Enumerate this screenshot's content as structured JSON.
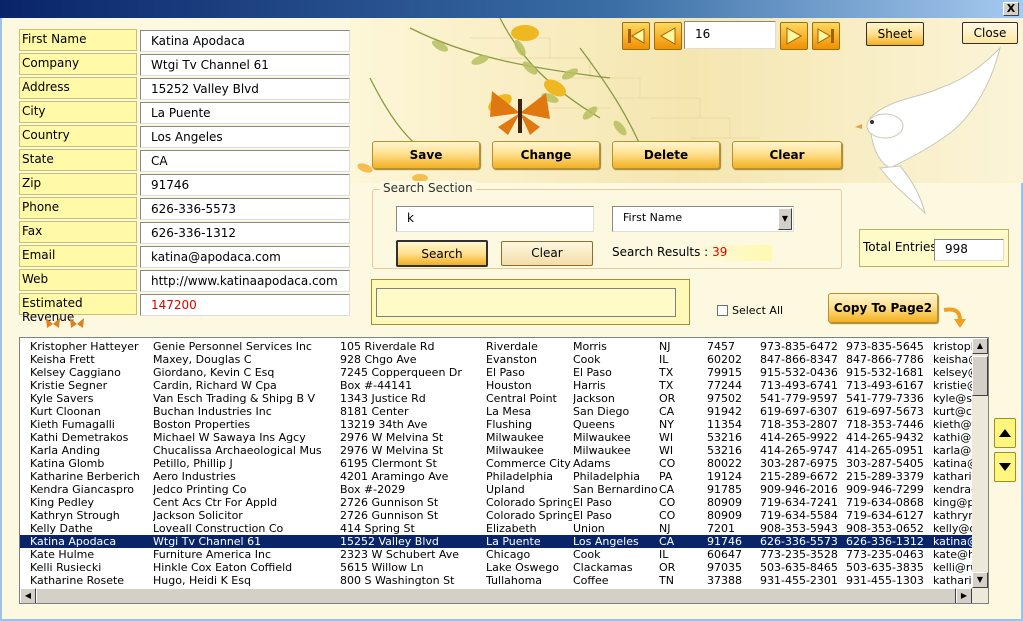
{
  "window": {
    "close_glyph": "X"
  },
  "form": {
    "fields": [
      {
        "label": "First Name",
        "value": "Katina Apodaca"
      },
      {
        "label": "Company",
        "value": "Wtgi Tv Channel 61"
      },
      {
        "label": "Address",
        "value": "15252 Valley Blvd"
      },
      {
        "label": "City",
        "value": "La Puente"
      },
      {
        "label": "Country",
        "value": "Los Angeles"
      },
      {
        "label": "State",
        "value": "CA"
      },
      {
        "label": "Zip",
        "value": "91746"
      },
      {
        "label": "Phone",
        "value": "626-336-5573"
      },
      {
        "label": "Fax",
        "value": "626-336-1312"
      },
      {
        "label": "Email",
        "value": "katina@apodaca.com"
      },
      {
        "label": "Web",
        "value": "http://www.katinaapodaca.com"
      },
      {
        "label": "Estimated Revenue",
        "value": "147200"
      }
    ]
  },
  "nav": {
    "record": "16"
  },
  "buttons": {
    "sheet": "Sheet",
    "close": "Close",
    "save": "Save",
    "change": "Change",
    "delete": "Delete",
    "clear": "Clear",
    "copy": "Copy To Page2"
  },
  "search": {
    "legend": "Search Section",
    "query": "k",
    "field": "First Name",
    "search_label": "Search",
    "clear_label": "Clear",
    "results_label": "Search Results :",
    "results_count": "39"
  },
  "totals": {
    "label": "Total Entries",
    "value": "998"
  },
  "select_all": "Select All",
  "colors": {
    "accent": "#f2b020",
    "selection": "#0a246a",
    "label_bg": "#fff9a8",
    "red_text": "#e00000"
  },
  "table": {
    "selected_index": 15,
    "rows": [
      [
        "Kristopher Hatteyer",
        "Genie Personnel Services Inc",
        "105 Riverdale Rd",
        "Riverdale",
        "Morris",
        "NJ",
        "7457",
        "973-835-6472",
        "973-835-5645",
        "kristoph"
      ],
      [
        "Keisha Frett",
        "Maxey, Douglas C",
        "928 Chgo Ave",
        "Evanston",
        "Cook",
        "IL",
        "60202",
        "847-866-8347",
        "847-866-7786",
        "keisha@"
      ],
      [
        "Kelsey Caggiano",
        "Giordano, Kevin C Esq",
        "7245 Copperqueen Dr",
        "El Paso",
        "El Paso",
        "TX",
        "79915",
        "915-532-0436",
        "915-532-1681",
        "kelsey@"
      ],
      [
        "Kristie Segner",
        "Cardin, Richard W Cpa",
        "Box #-44141",
        "Houston",
        "Harris",
        "TX",
        "77244",
        "713-493-6741",
        "713-493-6167",
        "kristie@"
      ],
      [
        "Kyle Savers",
        "Van Esch Trading & Shipg B V",
        "1343 Justice Rd",
        "Central Point",
        "Jackson",
        "OR",
        "97502",
        "541-779-9597",
        "541-779-7336",
        "kyle@sa"
      ],
      [
        "Kurt Cloonan",
        "Buchan Industries Inc",
        "8181 Center",
        "La Mesa",
        "San Diego",
        "CA",
        "91942",
        "619-697-6307",
        "619-697-5673",
        "kurt@cl"
      ],
      [
        "Kieth Fumagalli",
        "Boston Properties",
        "13219 34th Ave",
        "Flushing",
        "Queens",
        "NY",
        "11354",
        "718-353-2807",
        "718-353-7446",
        "kieth@f"
      ],
      [
        "Kathi Demetrakos",
        "Michael W Sawaya Ins Agcy",
        "2976 W Melvina St",
        "Milwaukee",
        "Milwaukee",
        "WI",
        "53216",
        "414-265-9922",
        "414-265-9432",
        "kathi@d"
      ],
      [
        "Karla Anding",
        "Chucalissa Archaeological Mus",
        "2976 W Melvina St",
        "Milwaukee",
        "Milwaukee",
        "WI",
        "53216",
        "414-265-9747",
        "414-265-0951",
        "karla@a"
      ],
      [
        "Katina Glomb",
        "Petillo, Phillip J",
        "6195 Clermont St",
        "Commerce City",
        "Adams",
        "CO",
        "80022",
        "303-287-6975",
        "303-287-5405",
        "katina@"
      ],
      [
        "Katharine Berberich",
        "Aero Industries",
        "4201 Aramingo Ave",
        "Philadelphia",
        "Philadelphia",
        "PA",
        "19124",
        "215-289-6672",
        "215-289-3379",
        "katharin"
      ],
      [
        "Kendra Giancaspro",
        "Jedco Printing Co",
        "Box #-2029",
        "Upland",
        "San Bernardino",
        "CA",
        "91785",
        "909-946-2016",
        "909-946-7299",
        "kendra@"
      ],
      [
        "King Pedley",
        "Cent Acs Ctr For Appld",
        "2726 Gunnison St",
        "Colorado Springs",
        "El Paso",
        "CO",
        "80909",
        "719-634-7241",
        "719-634-0868",
        "king@pe"
      ],
      [
        "Kathryn Strough",
        "Jackson Solicitor",
        "2726 Gunnison St",
        "Colorado Springs",
        "El Paso",
        "CO",
        "80909",
        "719-634-5584",
        "719-634-6127",
        "kathryn@"
      ],
      [
        "Kelly Dathe",
        "Loveall Construction Co",
        "414 Spring St",
        "Elizabeth",
        "Union",
        "NJ",
        "7201",
        "908-353-5943",
        "908-353-0652",
        "kelly@d"
      ],
      [
        "Katina Apodaca",
        "Wtgi Tv Channel 61",
        "15252 Valley Blvd",
        "La Puente",
        "Los Angeles",
        "CA",
        "91746",
        "626-336-5573",
        "626-336-1312",
        "katina@"
      ],
      [
        "Kate Hulme",
        "Furniture America Inc",
        "2323 W Schubert Ave",
        "Chicago",
        "Cook",
        "IL",
        "60647",
        "773-235-3528",
        "773-235-0463",
        "kate@h"
      ],
      [
        "Kelli Rusiecki",
        "Hinkle Cox Eaton Coffield",
        "5615 Willow Ln",
        "Lake Oswego",
        "Clackamas",
        "OR",
        "97035",
        "503-635-8465",
        "503-635-3835",
        "kelli@ru"
      ],
      [
        "Katharine Rosete",
        "Hugo, Heidi K Esq",
        "800 S Washington St",
        "Tullahoma",
        "Coffee",
        "TN",
        "37388",
        "931-455-2301",
        "931-455-1303",
        "katharin"
      ]
    ]
  }
}
